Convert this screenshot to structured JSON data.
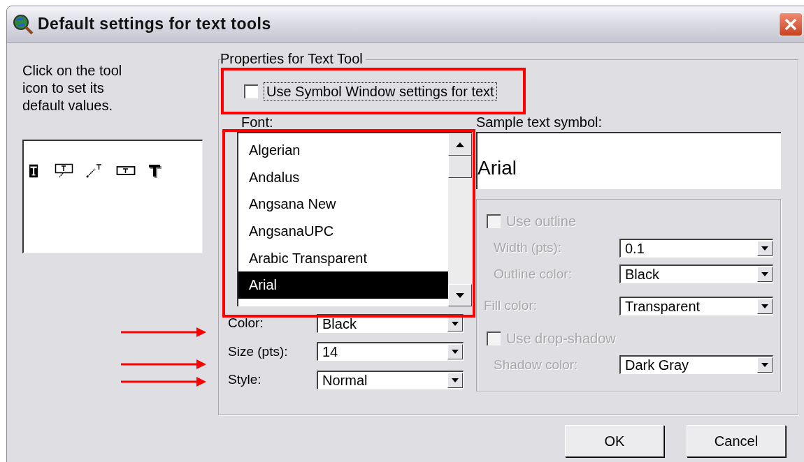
{
  "window": {
    "title": "Default settings for text tools"
  },
  "instructions": "Click on the tool icon to set its default values.",
  "tools": [
    {
      "kind": "text",
      "selected": true
    },
    {
      "kind": "callout",
      "selected": false
    },
    {
      "kind": "leader",
      "selected": false
    },
    {
      "kind": "box",
      "selected": false
    },
    {
      "kind": "shadow",
      "selected": false
    }
  ],
  "group": {
    "title": "Properties for Text Tool"
  },
  "use_symbol_window": {
    "label": "Use Symbol Window settings for text",
    "checked": false
  },
  "font": {
    "label": "Font:",
    "items": [
      {
        "name": "Algerian",
        "selected": false
      },
      {
        "name": "Andalus",
        "selected": false
      },
      {
        "name": "Angsana New",
        "selected": false
      },
      {
        "name": "AngsanaUPC",
        "selected": false
      },
      {
        "name": "Arabic Transparent",
        "selected": false
      },
      {
        "name": "Arial",
        "selected": true
      }
    ]
  },
  "fields": [
    {
      "label": "Color:",
      "value": "Black"
    },
    {
      "label": "Size (pts):",
      "value": "14"
    },
    {
      "label": "Style:",
      "value": "Normal"
    }
  ],
  "sample": {
    "label": "Sample text symbol:",
    "text": "Arial"
  },
  "effects": [
    {
      "kind": "option",
      "label": "Use outline",
      "checked": false,
      "disabled": true,
      "children": [
        {
          "label": "Width (pts):",
          "value": "0.1",
          "disabled": true
        },
        {
          "label": "Outline color:",
          "value": "Black",
          "disabled": true
        }
      ]
    },
    {
      "kind": "field",
      "label": "Fill color:",
      "value": "Transparent",
      "disabled": true
    },
    {
      "kind": "option",
      "label": "Use drop-shadow",
      "checked": false,
      "disabled": true,
      "children": [
        {
          "label": "Shadow color:",
          "value": "Dark Gray",
          "disabled": true
        }
      ]
    }
  ],
  "buttons": [
    {
      "label": "OK"
    },
    {
      "label": "Cancel"
    }
  ],
  "annotations": [
    {
      "kind": "frame"
    },
    {
      "kind": "frame"
    },
    {
      "kind": "arrow"
    },
    {
      "kind": "arrow"
    },
    {
      "kind": "arrow"
    }
  ]
}
